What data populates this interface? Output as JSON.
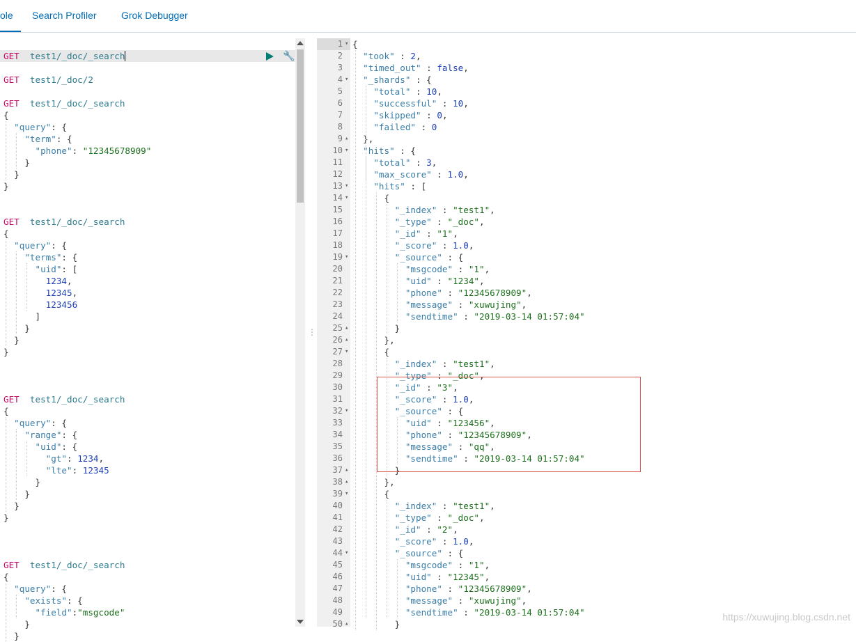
{
  "tabs": [
    {
      "label": "ole",
      "active": true
    },
    {
      "label": "Search Profiler",
      "active": false
    },
    {
      "label": "Grok Debugger",
      "active": false
    }
  ],
  "left_lines": [
    [],
    [
      [
        "m",
        "GET"
      ],
      [
        "p",
        "  "
      ],
      [
        "u",
        "test1/_doc/_search"
      ]
    ],
    [],
    [
      [
        "m",
        "GET"
      ],
      [
        "p",
        "  "
      ],
      [
        "u",
        "test1/_doc/2"
      ]
    ],
    [],
    [
      [
        "m",
        "GET"
      ],
      [
        "p",
        "  "
      ],
      [
        "u",
        "test1/_doc/_search"
      ]
    ],
    [
      [
        "p",
        "{"
      ]
    ],
    [
      [
        "p",
        "  "
      ],
      [
        "k",
        "\"query\""
      ],
      [
        "p",
        ": {"
      ]
    ],
    [
      [
        "p",
        "    "
      ],
      [
        "k",
        "\"term\""
      ],
      [
        "p",
        ": {"
      ]
    ],
    [
      [
        "p",
        "      "
      ],
      [
        "k",
        "\"phone\""
      ],
      [
        "p",
        ": "
      ],
      [
        "s",
        "\"12345678909\""
      ]
    ],
    [
      [
        "p",
        "    }"
      ]
    ],
    [
      [
        "p",
        "  }"
      ]
    ],
    [
      [
        "p",
        "}"
      ]
    ],
    [],
    [],
    [
      [
        "m",
        "GET"
      ],
      [
        "p",
        "  "
      ],
      [
        "u",
        "test1/_doc/_search"
      ]
    ],
    [
      [
        "p",
        "{"
      ]
    ],
    [
      [
        "p",
        "  "
      ],
      [
        "k",
        "\"query\""
      ],
      [
        "p",
        ": {"
      ]
    ],
    [
      [
        "p",
        "    "
      ],
      [
        "k",
        "\"terms\""
      ],
      [
        "p",
        ": {"
      ]
    ],
    [
      [
        "p",
        "      "
      ],
      [
        "k",
        "\"uid\""
      ],
      [
        "p",
        ": ["
      ]
    ],
    [
      [
        "p",
        "        "
      ],
      [
        "n",
        "1234"
      ],
      [
        "p",
        ","
      ]
    ],
    [
      [
        "p",
        "        "
      ],
      [
        "n",
        "12345"
      ],
      [
        "p",
        ","
      ]
    ],
    [
      [
        "p",
        "        "
      ],
      [
        "n",
        "123456"
      ]
    ],
    [
      [
        "p",
        "      ]"
      ]
    ],
    [
      [
        "p",
        "    }"
      ]
    ],
    [
      [
        "p",
        "  }"
      ]
    ],
    [
      [
        "p",
        "}"
      ]
    ],
    [],
    [],
    [],
    [
      [
        "m",
        "GET"
      ],
      [
        "p",
        "  "
      ],
      [
        "u",
        "test1/_doc/_search"
      ]
    ],
    [
      [
        "p",
        "{"
      ]
    ],
    [
      [
        "p",
        "  "
      ],
      [
        "k",
        "\"query\""
      ],
      [
        "p",
        ": {"
      ]
    ],
    [
      [
        "p",
        "    "
      ],
      [
        "k",
        "\"range\""
      ],
      [
        "p",
        ": {"
      ]
    ],
    [
      [
        "p",
        "      "
      ],
      [
        "k",
        "\"uid\""
      ],
      [
        "p",
        ": {"
      ]
    ],
    [
      [
        "p",
        "        "
      ],
      [
        "k",
        "\"gt\""
      ],
      [
        "p",
        ": "
      ],
      [
        "n",
        "1234"
      ],
      [
        "p",
        ","
      ]
    ],
    [
      [
        "p",
        "        "
      ],
      [
        "k",
        "\"lte\""
      ],
      [
        "p",
        ": "
      ],
      [
        "n",
        "12345"
      ]
    ],
    [
      [
        "p",
        "      }"
      ]
    ],
    [
      [
        "p",
        "    }"
      ]
    ],
    [
      [
        "p",
        "  }"
      ]
    ],
    [
      [
        "p",
        "}"
      ]
    ],
    [],
    [],
    [],
    [
      [
        "m",
        "GET"
      ],
      [
        "p",
        "  "
      ],
      [
        "u",
        "test1/_doc/_search"
      ]
    ],
    [
      [
        "p",
        "{"
      ]
    ],
    [
      [
        "p",
        "  "
      ],
      [
        "k",
        "\"query\""
      ],
      [
        "p",
        ": {"
      ]
    ],
    [
      [
        "p",
        "    "
      ],
      [
        "k",
        "\"exists\""
      ],
      [
        "p",
        ": {"
      ]
    ],
    [
      [
        "p",
        "      "
      ],
      [
        "k",
        "\"field\""
      ],
      [
        "p",
        ":"
      ],
      [
        "s",
        "\"msgcode\""
      ]
    ],
    [
      [
        "p",
        "    }"
      ]
    ],
    [
      [
        "p",
        "  }"
      ]
    ]
  ],
  "right_lines": [
    [
      [
        "p",
        "{"
      ]
    ],
    [
      [
        "p",
        "  "
      ],
      [
        "k",
        "\"took\""
      ],
      [
        "p",
        " : "
      ],
      [
        "n",
        "2"
      ],
      [
        "p",
        ","
      ]
    ],
    [
      [
        "p",
        "  "
      ],
      [
        "k",
        "\"timed_out\""
      ],
      [
        "p",
        " : "
      ],
      [
        "b",
        "false"
      ],
      [
        "p",
        ","
      ]
    ],
    [
      [
        "p",
        "  "
      ],
      [
        "k",
        "\"_shards\""
      ],
      [
        "p",
        " : {"
      ]
    ],
    [
      [
        "p",
        "    "
      ],
      [
        "k",
        "\"total\""
      ],
      [
        "p",
        " : "
      ],
      [
        "n",
        "10"
      ],
      [
        "p",
        ","
      ]
    ],
    [
      [
        "p",
        "    "
      ],
      [
        "k",
        "\"successful\""
      ],
      [
        "p",
        " : "
      ],
      [
        "n",
        "10"
      ],
      [
        "p",
        ","
      ]
    ],
    [
      [
        "p",
        "    "
      ],
      [
        "k",
        "\"skipped\""
      ],
      [
        "p",
        " : "
      ],
      [
        "n",
        "0"
      ],
      [
        "p",
        ","
      ]
    ],
    [
      [
        "p",
        "    "
      ],
      [
        "k",
        "\"failed\""
      ],
      [
        "p",
        " : "
      ],
      [
        "n",
        "0"
      ]
    ],
    [
      [
        "p",
        "  },"
      ]
    ],
    [
      [
        "p",
        "  "
      ],
      [
        "k",
        "\"hits\""
      ],
      [
        "p",
        " : {"
      ]
    ],
    [
      [
        "p",
        "    "
      ],
      [
        "k",
        "\"total\""
      ],
      [
        "p",
        " : "
      ],
      [
        "n",
        "3"
      ],
      [
        "p",
        ","
      ]
    ],
    [
      [
        "p",
        "    "
      ],
      [
        "k",
        "\"max_score\""
      ],
      [
        "p",
        " : "
      ],
      [
        "n",
        "1.0"
      ],
      [
        "p",
        ","
      ]
    ],
    [
      [
        "p",
        "    "
      ],
      [
        "k",
        "\"hits\""
      ],
      [
        "p",
        " : ["
      ]
    ],
    [
      [
        "p",
        "      {"
      ]
    ],
    [
      [
        "p",
        "        "
      ],
      [
        "k",
        "\"_index\""
      ],
      [
        "p",
        " : "
      ],
      [
        "s",
        "\"test1\""
      ],
      [
        "p",
        ","
      ]
    ],
    [
      [
        "p",
        "        "
      ],
      [
        "k",
        "\"_type\""
      ],
      [
        "p",
        " : "
      ],
      [
        "s",
        "\"_doc\""
      ],
      [
        "p",
        ","
      ]
    ],
    [
      [
        "p",
        "        "
      ],
      [
        "k",
        "\"_id\""
      ],
      [
        "p",
        " : "
      ],
      [
        "s",
        "\"1\""
      ],
      [
        "p",
        ","
      ]
    ],
    [
      [
        "p",
        "        "
      ],
      [
        "k",
        "\"_score\""
      ],
      [
        "p",
        " : "
      ],
      [
        "n",
        "1.0"
      ],
      [
        "p",
        ","
      ]
    ],
    [
      [
        "p",
        "        "
      ],
      [
        "k",
        "\"_source\""
      ],
      [
        "p",
        " : {"
      ]
    ],
    [
      [
        "p",
        "          "
      ],
      [
        "k",
        "\"msgcode\""
      ],
      [
        "p",
        " : "
      ],
      [
        "s",
        "\"1\""
      ],
      [
        "p",
        ","
      ]
    ],
    [
      [
        "p",
        "          "
      ],
      [
        "k",
        "\"uid\""
      ],
      [
        "p",
        " : "
      ],
      [
        "s",
        "\"1234\""
      ],
      [
        "p",
        ","
      ]
    ],
    [
      [
        "p",
        "          "
      ],
      [
        "k",
        "\"phone\""
      ],
      [
        "p",
        " : "
      ],
      [
        "s",
        "\"12345678909\""
      ],
      [
        "p",
        ","
      ]
    ],
    [
      [
        "p",
        "          "
      ],
      [
        "k",
        "\"message\""
      ],
      [
        "p",
        " : "
      ],
      [
        "s",
        "\"xuwujing\""
      ],
      [
        "p",
        ","
      ]
    ],
    [
      [
        "p",
        "          "
      ],
      [
        "k",
        "\"sendtime\""
      ],
      [
        "p",
        " : "
      ],
      [
        "s",
        "\"2019-03-14 01:57:04\""
      ]
    ],
    [
      [
        "p",
        "        }"
      ]
    ],
    [
      [
        "p",
        "      },"
      ]
    ],
    [
      [
        "p",
        "      {"
      ]
    ],
    [
      [
        "p",
        "        "
      ],
      [
        "k",
        "\"_index\""
      ],
      [
        "p",
        " : "
      ],
      [
        "s",
        "\"test1\""
      ],
      [
        "p",
        ","
      ]
    ],
    [
      [
        "p",
        "        "
      ],
      [
        "k",
        "\"_type\""
      ],
      [
        "p",
        " : "
      ],
      [
        "s",
        "\"_doc\""
      ],
      [
        "p",
        ","
      ]
    ],
    [
      [
        "p",
        "        "
      ],
      [
        "k",
        "\"_id\""
      ],
      [
        "p",
        " : "
      ],
      [
        "s",
        "\"3\""
      ],
      [
        "p",
        ","
      ]
    ],
    [
      [
        "p",
        "        "
      ],
      [
        "k",
        "\"_score\""
      ],
      [
        "p",
        " : "
      ],
      [
        "n",
        "1.0"
      ],
      [
        "p",
        ","
      ]
    ],
    [
      [
        "p",
        "        "
      ],
      [
        "k",
        "\"_source\""
      ],
      [
        "p",
        " : {"
      ]
    ],
    [
      [
        "p",
        "          "
      ],
      [
        "k",
        "\"uid\""
      ],
      [
        "p",
        " : "
      ],
      [
        "s",
        "\"123456\""
      ],
      [
        "p",
        ","
      ]
    ],
    [
      [
        "p",
        "          "
      ],
      [
        "k",
        "\"phone\""
      ],
      [
        "p",
        " : "
      ],
      [
        "s",
        "\"12345678909\""
      ],
      [
        "p",
        ","
      ]
    ],
    [
      [
        "p",
        "          "
      ],
      [
        "k",
        "\"message\""
      ],
      [
        "p",
        " : "
      ],
      [
        "s",
        "\"qq\""
      ],
      [
        "p",
        ","
      ]
    ],
    [
      [
        "p",
        "          "
      ],
      [
        "k",
        "\"sendtime\""
      ],
      [
        "p",
        " : "
      ],
      [
        "s",
        "\"2019-03-14 01:57:04\""
      ]
    ],
    [
      [
        "p",
        "        }"
      ]
    ],
    [
      [
        "p",
        "      },"
      ]
    ],
    [
      [
        "p",
        "      {"
      ]
    ],
    [
      [
        "p",
        "        "
      ],
      [
        "k",
        "\"_index\""
      ],
      [
        "p",
        " : "
      ],
      [
        "s",
        "\"test1\""
      ],
      [
        "p",
        ","
      ]
    ],
    [
      [
        "p",
        "        "
      ],
      [
        "k",
        "\"_type\""
      ],
      [
        "p",
        " : "
      ],
      [
        "s",
        "\"_doc\""
      ],
      [
        "p",
        ","
      ]
    ],
    [
      [
        "p",
        "        "
      ],
      [
        "k",
        "\"_id\""
      ],
      [
        "p",
        " : "
      ],
      [
        "s",
        "\"2\""
      ],
      [
        "p",
        ","
      ]
    ],
    [
      [
        "p",
        "        "
      ],
      [
        "k",
        "\"_score\""
      ],
      [
        "p",
        " : "
      ],
      [
        "n",
        "1.0"
      ],
      [
        "p",
        ","
      ]
    ],
    [
      [
        "p",
        "        "
      ],
      [
        "k",
        "\"_source\""
      ],
      [
        "p",
        " : {"
      ]
    ],
    [
      [
        "p",
        "          "
      ],
      [
        "k",
        "\"msgcode\""
      ],
      [
        "p",
        " : "
      ],
      [
        "s",
        "\"1\""
      ],
      [
        "p",
        ","
      ]
    ],
    [
      [
        "p",
        "          "
      ],
      [
        "k",
        "\"uid\""
      ],
      [
        "p",
        " : "
      ],
      [
        "s",
        "\"12345\""
      ],
      [
        "p",
        ","
      ]
    ],
    [
      [
        "p",
        "          "
      ],
      [
        "k",
        "\"phone\""
      ],
      [
        "p",
        " : "
      ],
      [
        "s",
        "\"12345678909\""
      ],
      [
        "p",
        ","
      ]
    ],
    [
      [
        "p",
        "          "
      ],
      [
        "k",
        "\"message\""
      ],
      [
        "p",
        " : "
      ],
      [
        "s",
        "\"xuwujing\""
      ],
      [
        "p",
        ","
      ]
    ],
    [
      [
        "p",
        "          "
      ],
      [
        "k",
        "\"sendtime\""
      ],
      [
        "p",
        " : "
      ],
      [
        "s",
        "\"2019-03-14 01:57:04\""
      ]
    ],
    [
      [
        "p",
        "        }"
      ]
    ]
  ],
  "right_line_numbers": [
    "1",
    "2",
    "3",
    "4",
    "5",
    "6",
    "7",
    "8",
    "9",
    "10",
    "11",
    "12",
    "13",
    "14",
    "15",
    "16",
    "17",
    "18",
    "19",
    "20",
    "21",
    "22",
    "23",
    "24",
    "25",
    "26",
    "27",
    "28",
    "29",
    "30",
    "31",
    "32",
    "33",
    "34",
    "35",
    "36",
    "37",
    "38",
    "39",
    "40",
    "41",
    "42",
    "43",
    "44",
    "45",
    "46",
    "47",
    "48",
    "49",
    "50"
  ],
  "right_folds": {
    "1": "down",
    "4": "down",
    "9": "up",
    "10": "down",
    "13": "down",
    "14": "down",
    "19": "down",
    "25": "up",
    "26": "up",
    "27": "down",
    "32": "down",
    "37": "up",
    "38": "up",
    "39": "down",
    "44": "down",
    "50": "up"
  },
  "icons": {
    "run": "play-icon",
    "settings": "wrench-icon",
    "resize": "drag-handle-icon"
  },
  "colors": {
    "method": "#c80a68",
    "url": "#2a7a8c",
    "key": "#3a7ea8",
    "string": "#1c6f1c",
    "number": "#1d3fb8",
    "accent": "#006bb4",
    "highlight_box": "#d9534f"
  },
  "watermark": "https://xuwujing.blog.csdn.net"
}
